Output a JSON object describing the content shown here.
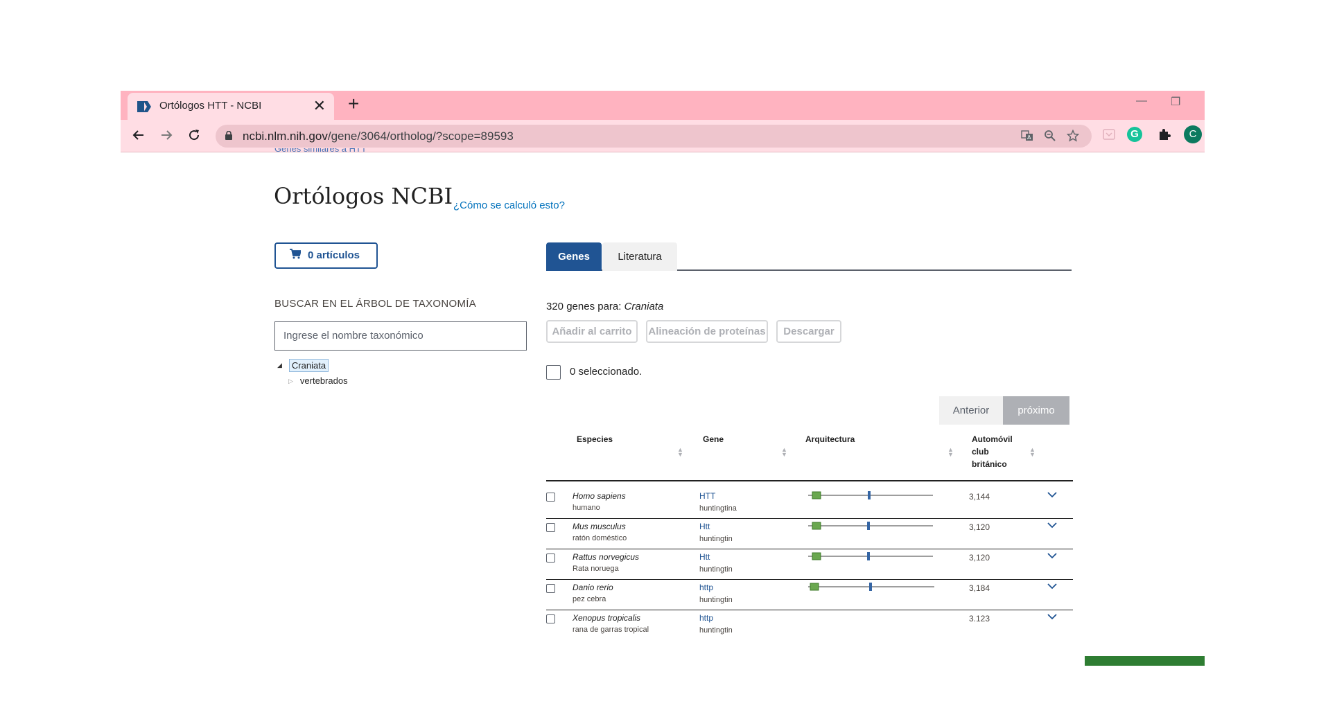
{
  "browser": {
    "tab_title": "Ortólogos HTT - NCBI",
    "tab_close": "✕",
    "new_tab": "+",
    "minimize": "—",
    "restore": "❐",
    "url_domain": "ncbi.nlm.nih.gov",
    "url_path": "/gene/3064/ortholog/?scope=89593",
    "profile_initial": "C",
    "grammarly_letter": "G"
  },
  "page": {
    "cutoff_text": "Genes similares a HTT",
    "title": "Ortólogos NCBI",
    "how_link": "¿Cómo se calculó esto?",
    "cart_label": "0 artículos",
    "taxonomy_heading": "BUSCAR EN EL ÁRBOL DE TAXONOMÍA",
    "taxonomy_placeholder": "Ingrese el nombre taxonómico",
    "tree": {
      "root": "Craniata",
      "child": "vertebrados"
    },
    "tabs": {
      "genes": "Genes",
      "literature": "Literatura"
    },
    "count_prefix": "320 genes para: ",
    "count_taxon": "Craniata",
    "buttons": {
      "add_cart": "Añadir al carrito",
      "align": "Alineación de proteínas",
      "download": "Descargar"
    },
    "selected": "0 seleccionado.",
    "pager": {
      "prev": "Anterior",
      "next": "próximo"
    },
    "columns": {
      "species": "Especies",
      "gene": "Gene",
      "architecture": "Arquitectura",
      "length_1": "Automóvil",
      "length_2": "club",
      "length_3": "británico"
    }
  },
  "rows": [
    {
      "species": "Homo sapiens",
      "common": "humano",
      "gene": "HTT",
      "desc": "huntingtina",
      "length": "3,144"
    },
    {
      "species": "Mus musculus",
      "common": "ratón doméstico",
      "gene": "Htt",
      "desc": "huntingtin",
      "length": "3,120"
    },
    {
      "species": "Rattus norvegicus",
      "common": "Rata noruega",
      "gene": "Htt",
      "desc": "huntingtin",
      "length": "3,120"
    },
    {
      "species": "Danio rerio",
      "common": "pez cebra",
      "gene": "http",
      "desc": "huntingtin",
      "length": "3,184"
    },
    {
      "species": "Xenopus tropicalis",
      "common": "rana de garras tropical",
      "gene": "http",
      "desc": "huntingtin",
      "length": "3.123"
    }
  ],
  "colors": {
    "tab_strip": "#ffb3c0",
    "toolbar": "#ffdde4",
    "ncbi_blue": "#205493",
    "link": "#0071bc",
    "domain_green": "#6aa84f",
    "domain_blue": "#3465a4"
  }
}
